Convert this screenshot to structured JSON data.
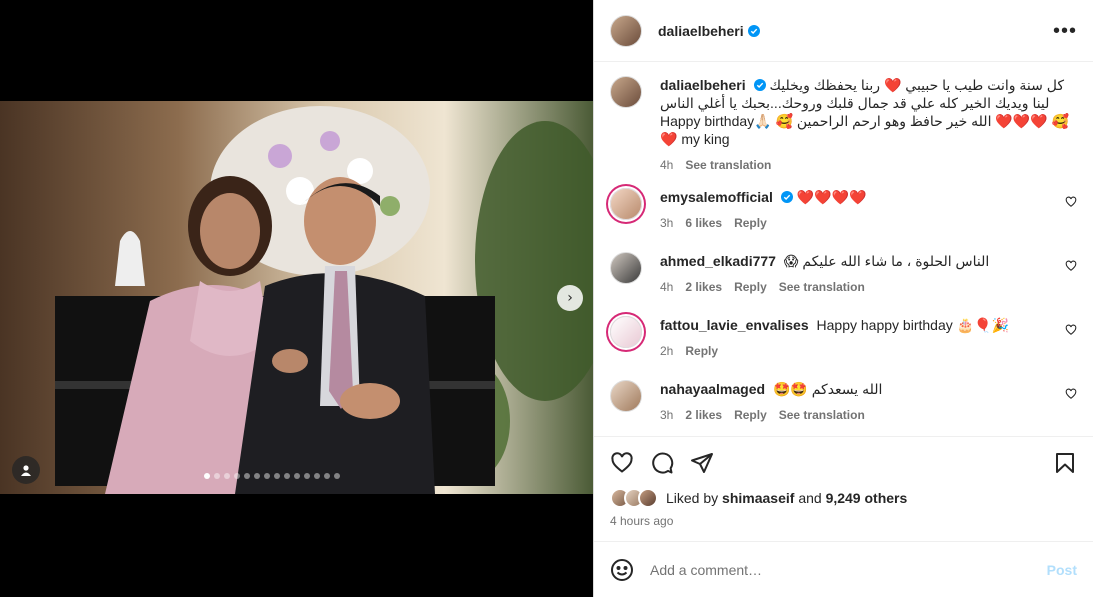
{
  "post": {
    "author": "daliaelbeheri",
    "carousel": {
      "slide_count": 14,
      "active_index": 0
    }
  },
  "caption": {
    "author": "daliaelbeheri",
    "line1": "كل سنة وانت طيب يا حبيبي ❤️ ربنا يحفظك ويخليك",
    "line2": "لينا ويديك الخير كله علي قد جمال قلبك وروحك...بحبك يا أغلي الناس",
    "line3": "Happy birthday🙏🏻 🥰 الله خير حافظ وهو ارحم الراحمين ❤️❤️❤️ 🥰",
    "line4": "❤️ my king",
    "time": "4h",
    "see_translation": "See translation"
  },
  "comments": [
    {
      "user": "emysalemofficial",
      "verified": true,
      "text": "❤️❤️❤️❤️",
      "time": "3h",
      "likes": "6 likes",
      "reply": "Reply",
      "translate": ""
    },
    {
      "user": "ahmed_elkadi777",
      "verified": false,
      "text": "الناس الحلوة ، ما شاء الله عليكم 😱",
      "time": "4h",
      "likes": "2 likes",
      "reply": "Reply",
      "translate": "See translation"
    },
    {
      "user": "fattou_lavie_envalises",
      "verified": false,
      "text": "Happy happy birthday 🎂🎈🎉",
      "time": "2h",
      "likes": "",
      "reply": "Reply",
      "translate": ""
    },
    {
      "user": "nahayaalmaged",
      "verified": false,
      "text": "الله يسعدكم 🤩🤩",
      "time": "3h",
      "likes": "2 likes",
      "reply": "Reply",
      "translate": "See translation"
    }
  ],
  "likes": {
    "prefix": "Liked by",
    "user": "shimaaseif",
    "and": "and",
    "others": "9,249 others"
  },
  "timestamp": "4 hours ago",
  "comment_box": {
    "placeholder": "Add a comment…",
    "post_label": "Post"
  },
  "colors": {
    "verified": "#0095f6",
    "heart": "#ed4956",
    "post_disabled": "#b2dffc",
    "muted": "#737373"
  },
  "icons": [
    "verified-icon",
    "more-icon",
    "like-icon",
    "comment-icon",
    "share-icon",
    "save-icon",
    "emoji-icon",
    "chevron-right-icon",
    "user-tag-icon"
  ]
}
